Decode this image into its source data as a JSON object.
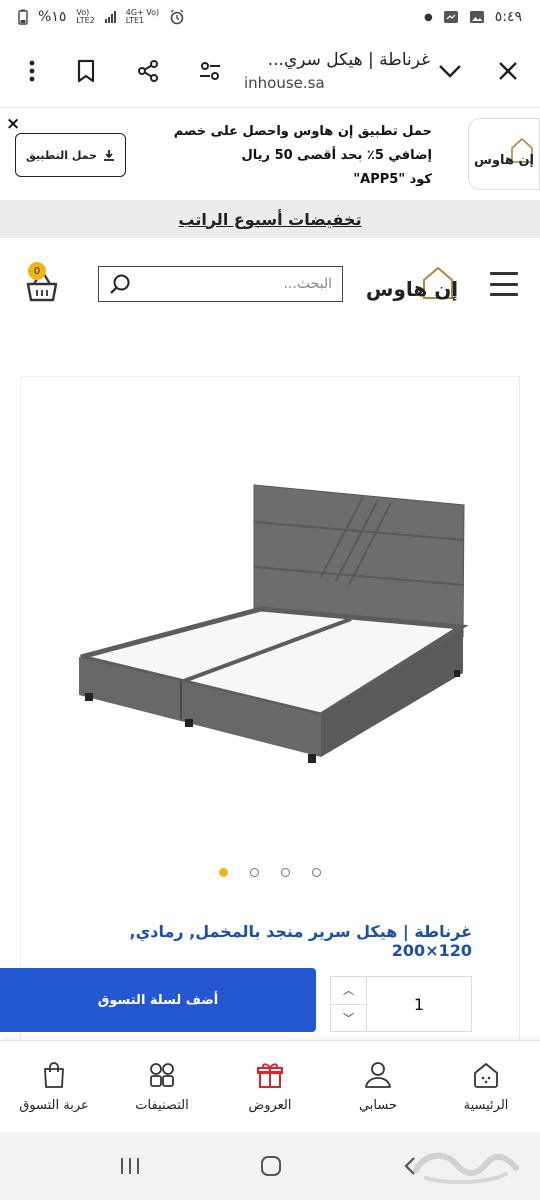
{
  "statusbar": {
    "time": "٥:٤٩",
    "battery": "%١٥",
    "net1_top": "Vo)",
    "net1_bottom": "LTE2",
    "net2_top": "4G+ Vo)",
    "net2_bottom": "LTE1"
  },
  "browser": {
    "tab_title": "غرناطة | هيكل سري...",
    "domain": "inhouse.sa"
  },
  "app_banner": {
    "line1": "حمل تطبيق إن هاوس واحصل على خصم",
    "line2": "إضافي 5٪ بحد أقصى 50 ريال",
    "line3": "كود \"APP5\"",
    "button_label": "حمل التطبيق",
    "close_label": "×"
  },
  "promo": {
    "text": "تخفيضات أسبوع الراتب"
  },
  "header": {
    "search_placeholder": "البحث...",
    "cart_count": "0"
  },
  "product": {
    "title": "غرناطة | هيكل سرير منجد بالمخمل, رمادي, 120×200",
    "image_count": 4,
    "active_image": 1,
    "bed_color": "#6f6c6c"
  },
  "purchase": {
    "add_to_cart_label": "أضف لسلة التسوق",
    "quantity": "1",
    "increment_symbol": "︿",
    "decrement_symbol": "﹀"
  },
  "tabbar": {
    "items": [
      {
        "label": "عربة التسوق",
        "icon": "bag-icon"
      },
      {
        "label": "التصنيفات",
        "icon": "grid-icon"
      },
      {
        "label": "العروض",
        "icon": "gift-icon"
      },
      {
        "label": "حسابي",
        "icon": "user-icon"
      },
      {
        "label": "الرئيسية",
        "icon": "home-icon"
      }
    ]
  },
  "colors": {
    "accent_blue": "#2456d0",
    "title_blue": "#1e4fa8",
    "badge_yellow": "#f0b31a",
    "gift_red": "#d8262f"
  }
}
